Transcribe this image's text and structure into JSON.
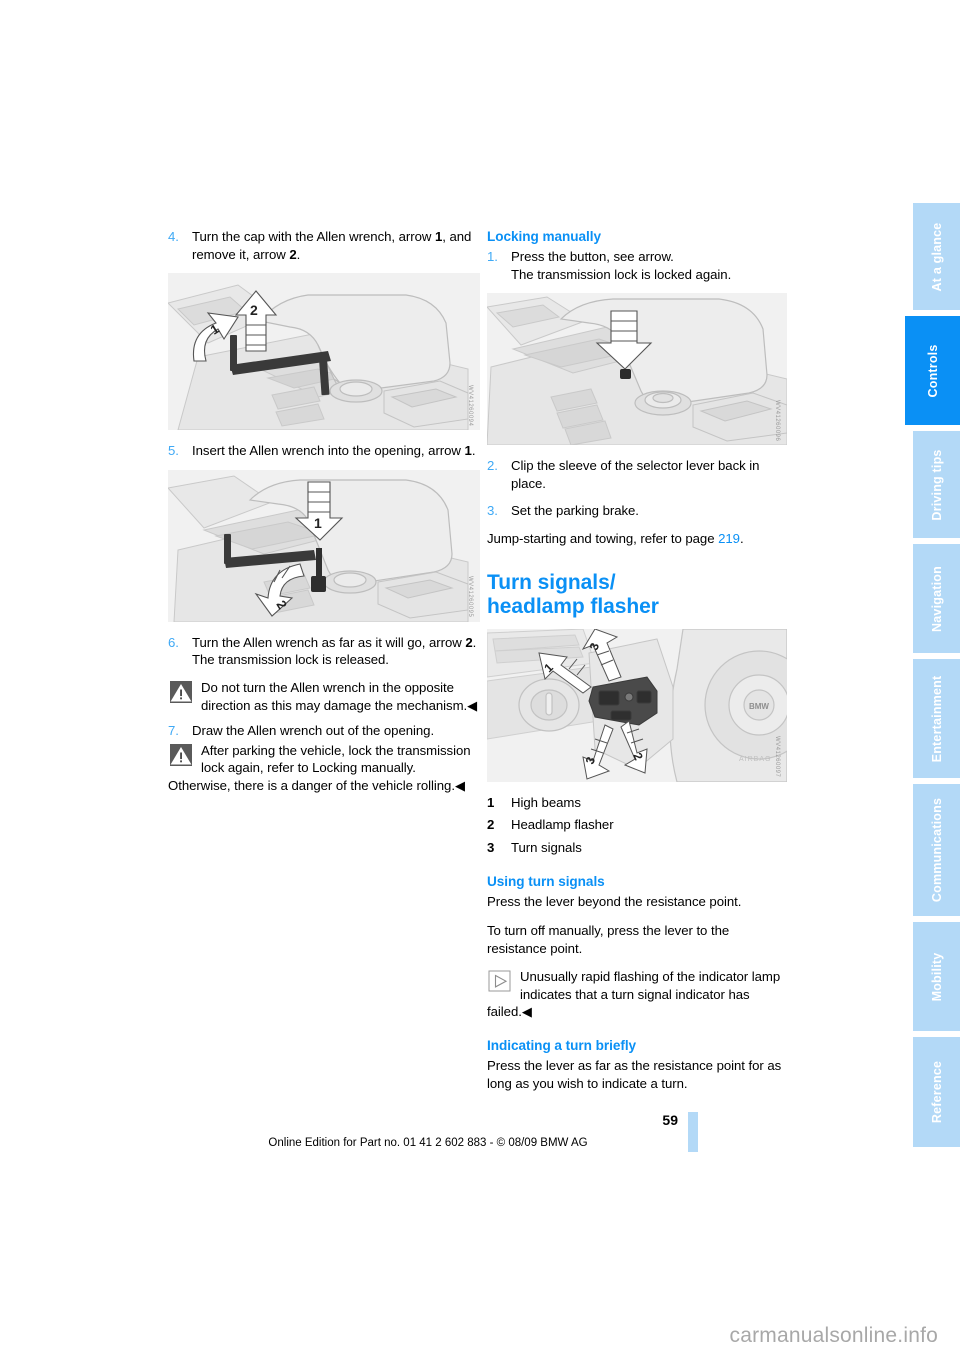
{
  "document": {
    "page_number": "59",
    "imprint": "Online Edition for Part no. 01 41 2 602 883 - © 08/09 BMW AG",
    "watermark": "carmanualsonline.info"
  },
  "colors": {
    "accent_blue": "#0a90f5",
    "light_blue": "#b3d9f7",
    "step_number_blue": "#3fa9f5",
    "figure_bg": "#f1f1f1"
  },
  "sidebar": {
    "tabs": [
      {
        "label": "At a glance",
        "active": false
      },
      {
        "label": "Controls",
        "active": true
      },
      {
        "label": "Driving tips",
        "active": false
      },
      {
        "label": "Navigation",
        "active": false
      },
      {
        "label": "Entertainment",
        "active": false
      },
      {
        "label": "Communications",
        "active": false
      },
      {
        "label": "Mobility",
        "active": false
      },
      {
        "label": "Reference",
        "active": false
      }
    ]
  },
  "left_column": {
    "step4": {
      "num": "4.",
      "text_a": "Turn the cap with the Allen wrench, arrow ",
      "bold_a": "1",
      "text_b": ", and remove it, arrow ",
      "bold_b": "2",
      "text_c": "."
    },
    "figure1": {
      "name": "center-console-allen-wrench-cap-removal",
      "code": "WV41260094",
      "arrow_labels": [
        "1",
        "2"
      ]
    },
    "step5": {
      "num": "5.",
      "text_a": "Insert the Allen wrench into the opening, arrow ",
      "bold_a": "1",
      "text_b": "."
    },
    "figure2": {
      "name": "center-console-allen-wrench-inserted",
      "code": "WV41260095",
      "arrow_labels": [
        "1",
        "2"
      ]
    },
    "step6": {
      "num": "6.",
      "text_a": "Turn the Allen wrench as far as it will go, arrow ",
      "bold_a": "2",
      "text_b": ". The transmission lock is released."
    },
    "note_warning_1": {
      "icon": "warning-triangle-icon",
      "text": "Do not turn the Allen wrench in the opposite direction as this may damage the mechanism.◀"
    },
    "step7": {
      "num": "7.",
      "text_a": "Draw the Allen wrench out of the opening."
    },
    "note_warning_2": {
      "icon": "warning-triangle-icon",
      "text": "After parking the vehicle, lock the transmission lock again, refer to Locking manually. Otherwise, there is a danger of the vehicle rolling.◀"
    }
  },
  "right_column": {
    "heading_locking": "Locking manually",
    "step1": {
      "num": "1.",
      "line1": "Press the button, see arrow.",
      "line2": "The transmission lock is locked again."
    },
    "figure3": {
      "name": "center-console-lock-button-arrow",
      "code": "WV41260096"
    },
    "step2": {
      "num": "2.",
      "text": "Clip the sleeve of the selector lever back in place."
    },
    "step3": {
      "num": "3.",
      "text": "Set the parking brake."
    },
    "cross_ref": {
      "text_a": "Jump-starting and towing, refer to page ",
      "page": "219",
      "text_b": "."
    },
    "heading_turn_signals_line1": "Turn signals/",
    "heading_turn_signals_line2": "headlamp flasher",
    "figure4": {
      "name": "steering-column-stalk-turn-signals",
      "code": "WV41260097",
      "arrow_labels": [
        "1",
        "2",
        "3"
      ],
      "badge": "BMW"
    },
    "legend": [
      {
        "num": "1",
        "label": "High beams"
      },
      {
        "num": "2",
        "label": "Headlamp flasher"
      },
      {
        "num": "3",
        "label": "Turn signals"
      }
    ],
    "heading_using": "Using turn signals",
    "para_using_1": "Press the lever beyond the resistance point.",
    "para_using_2": "To turn off manually, press the lever to the resistance point.",
    "note_info": {
      "icon": "info-triangle-icon",
      "text": "Unusually rapid flashing of the indicator lamp indicates that a turn signal indicator has failed.◀"
    },
    "heading_briefly": "Indicating a turn briefly",
    "para_briefly": "Press the lever as far as the resistance point for as long as you wish to indicate a turn."
  }
}
